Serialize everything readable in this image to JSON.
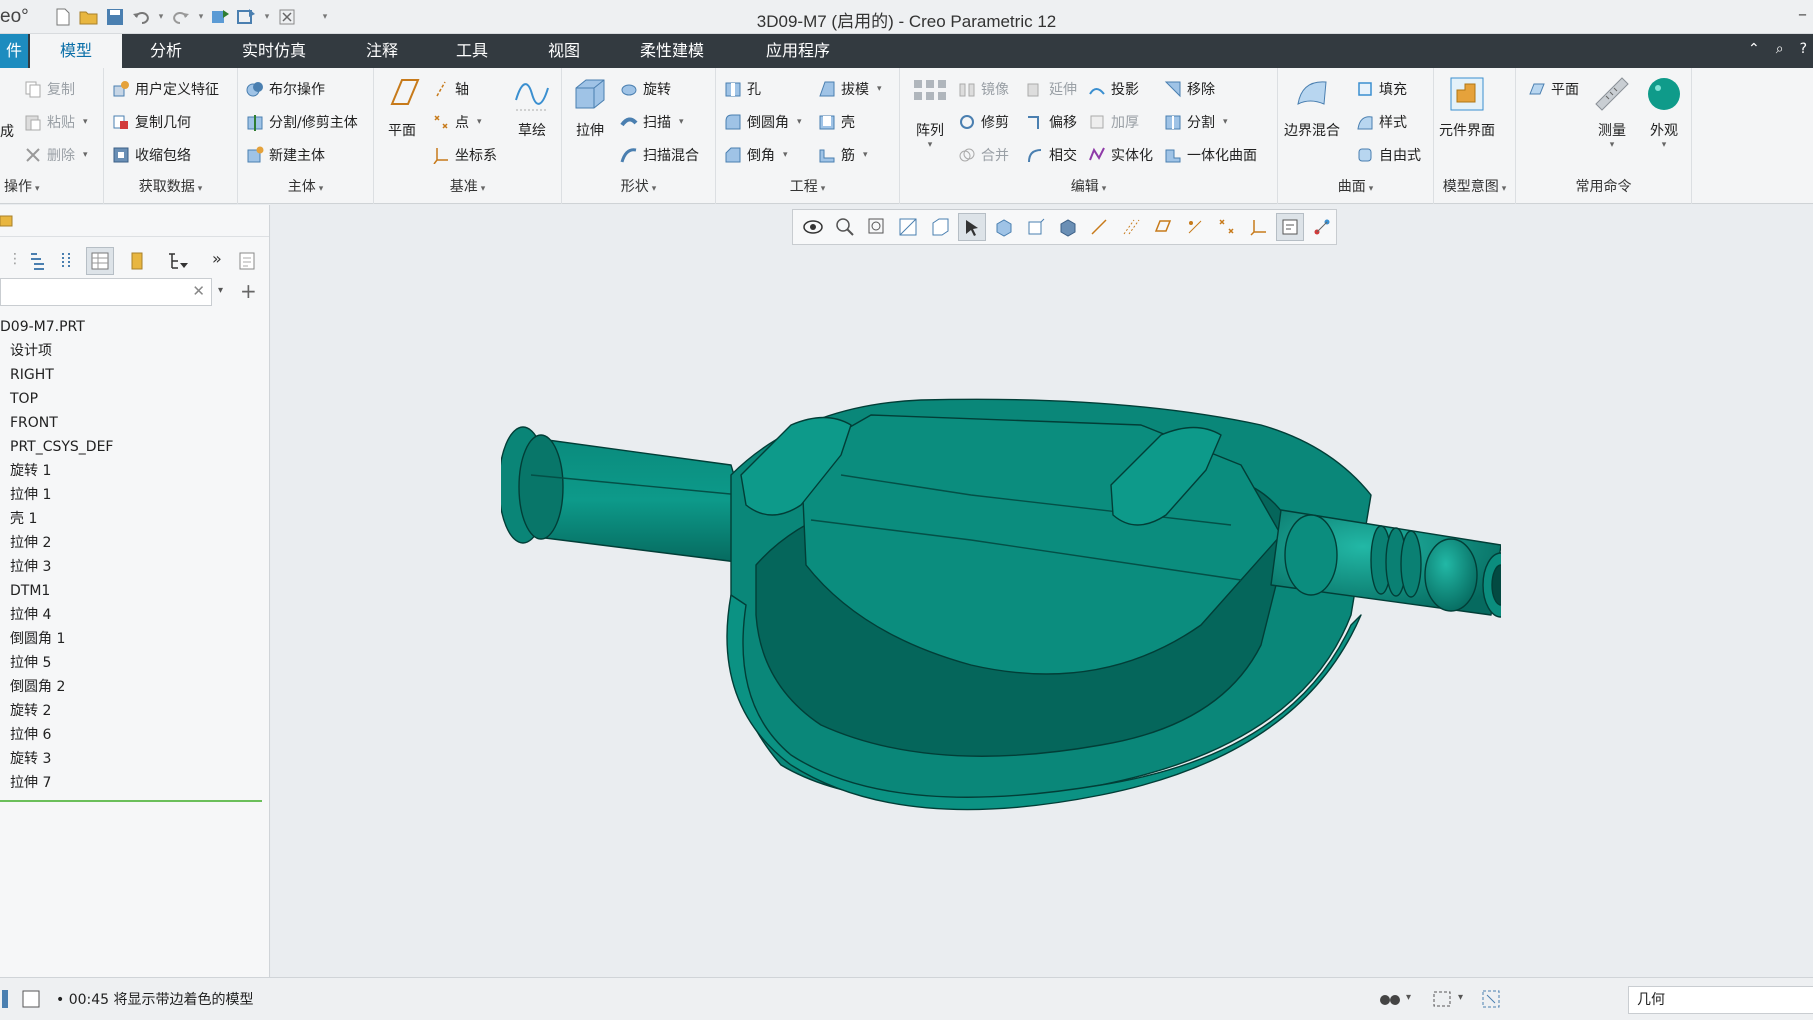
{
  "window": {
    "app_logo": "eo°",
    "title": "3D09-M7 (启用的) - Creo Parametric 12",
    "minimize": "–"
  },
  "menu": {
    "file_tab": "件",
    "tabs": [
      "模型",
      "分析",
      "实时仿真",
      "注释",
      "工具",
      "视图",
      "柔性建模",
      "应用程序"
    ],
    "active_tab": "模型"
  },
  "ribbon": {
    "operations": {
      "items": [
        "复制",
        "粘贴",
        "删除"
      ],
      "left_partial": "成",
      "group": "操作"
    },
    "get_data": {
      "items": [
        "用户定义特征",
        "复制几何",
        "收缩包络"
      ],
      "group": "获取数据"
    },
    "body": {
      "items": [
        "布尔操作",
        "分割/修剪主体",
        "新建主体"
      ],
      "group": "主体"
    },
    "datum": {
      "plane": "平面",
      "axis": "轴",
      "point": "点",
      "csys": "坐标系",
      "sketch": "草绘",
      "group": "基准"
    },
    "shapes": {
      "extrude": "拉伸",
      "revolve": "旋转",
      "sweep": "扫描",
      "swept_blend": "扫描混合",
      "group": "形状"
    },
    "engineering": {
      "hole": "孔",
      "round": "倒圆角",
      "chamfer": "倒角",
      "draft": "拔模",
      "shell": "壳",
      "rib": "筋",
      "group": "工程"
    },
    "editing": {
      "pattern": "阵列",
      "mirror": "镜像",
      "extend": "延伸",
      "project": "投影",
      "remove": "移除",
      "trim": "修剪",
      "offset": "偏移",
      "thicken": "加厚",
      "split": "分割",
      "merge": "合并",
      "intersect": "相交",
      "solidify": "实体化",
      "unify_surface": "一体化曲面",
      "group": "编辑"
    },
    "surfaces": {
      "boundary_blend": "边界混合",
      "fill": "填充",
      "style": "样式",
      "freestyle": "自由式",
      "group": "曲面"
    },
    "model_intent": {
      "component_interface": "元件界面",
      "group": "模型意图"
    },
    "common": {
      "plane": "平面",
      "measure": "测量",
      "appearance": "外观",
      "group": "常用命令"
    }
  },
  "model_tree": {
    "items": [
      "D09-M7.PRT",
      "设计项",
      "RIGHT",
      "TOP",
      "FRONT",
      "PRT_CSYS_DEF",
      "旋转 1",
      "拉伸 1",
      "壳 1",
      "拉伸 2",
      "拉伸 3",
      "DTM1",
      "拉伸 4",
      "倒圆角 1",
      "拉伸 5",
      "倒圆角 2",
      "旋转 2",
      "拉伸 6",
      "旋转 3",
      "拉伸 7"
    ],
    "search_value": ""
  },
  "status": {
    "message": "• 00:45  将显示带边着色的模型",
    "filter_value": "几何"
  },
  "colors": {
    "model_teal": "#08877a",
    "model_dark": "#05665b",
    "model_light": "#14a393",
    "menubar": "#333a40",
    "accent": "#1d8cbf"
  }
}
